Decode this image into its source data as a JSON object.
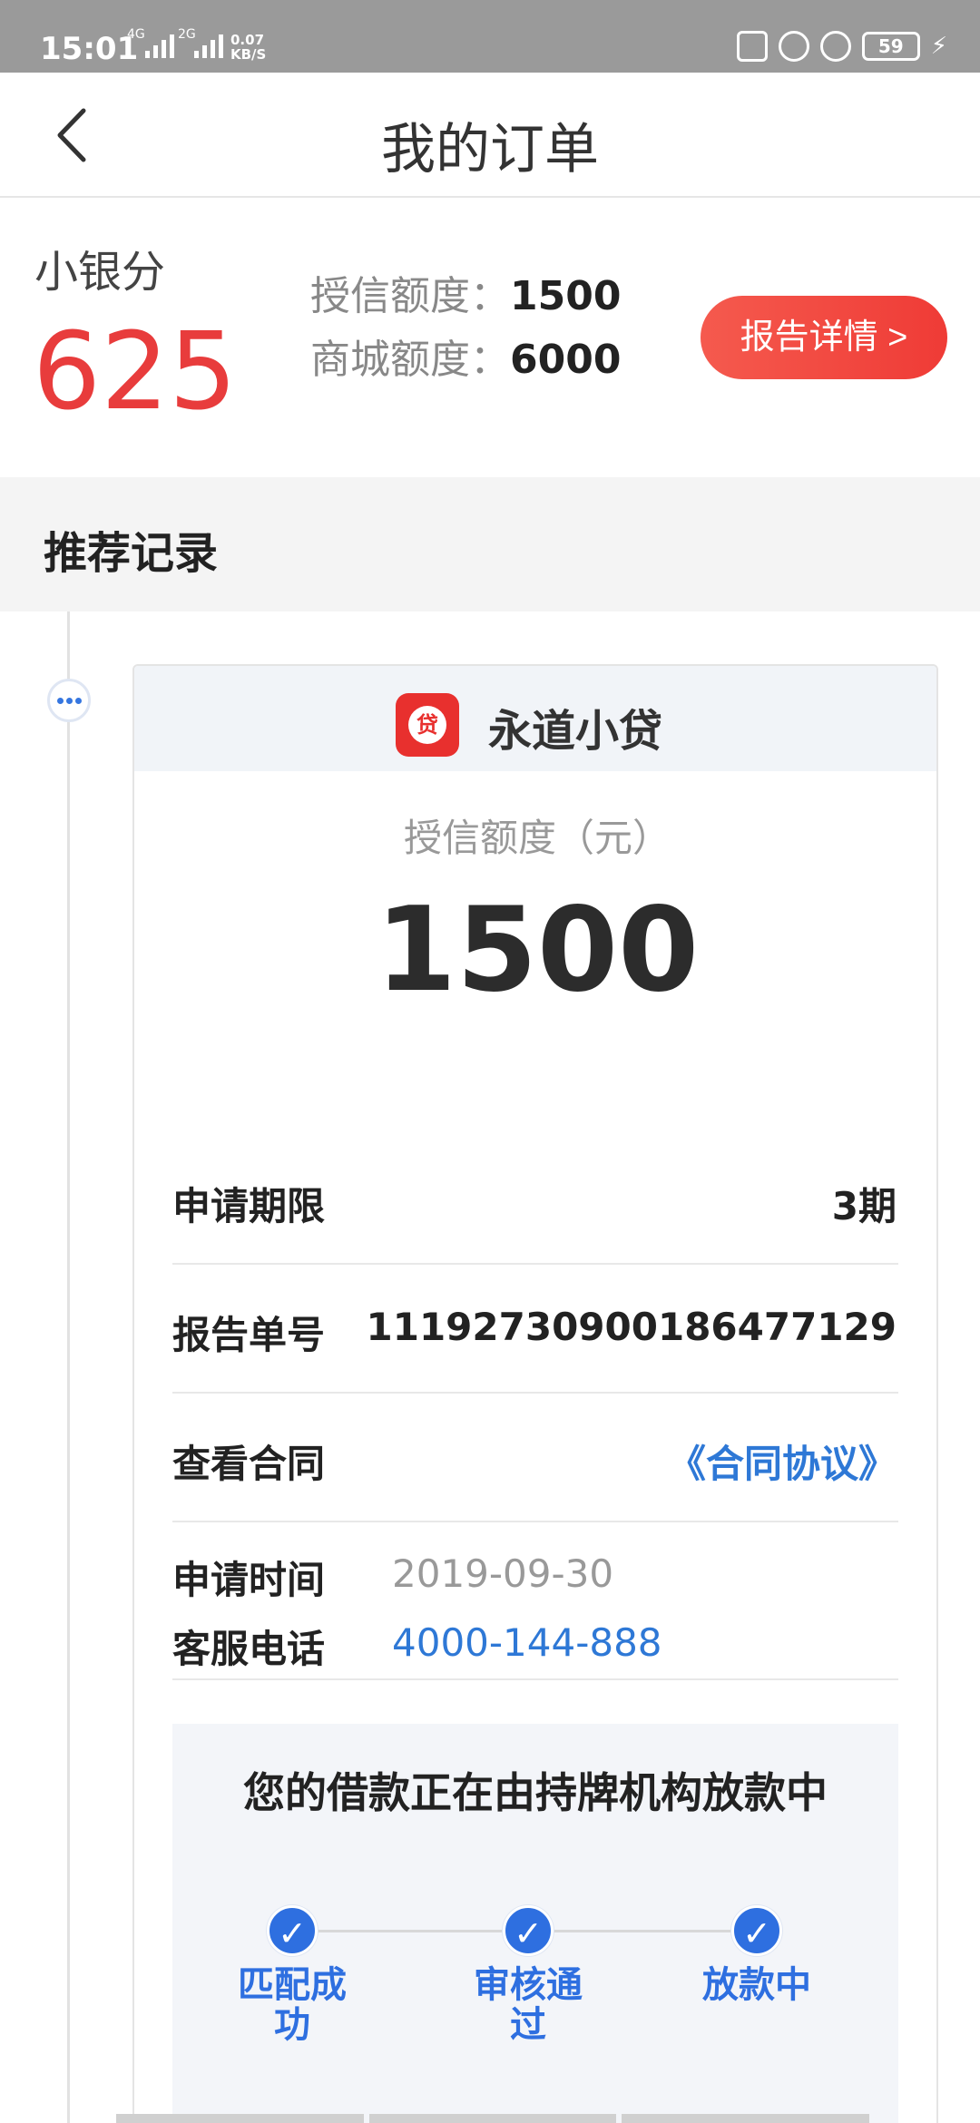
{
  "status_bar": {
    "time": "15:01",
    "net1": "4G",
    "net2": "2G",
    "speed_value": "0.07",
    "speed_unit": "KB/S",
    "battery": "59"
  },
  "header": {
    "title": "我的订单"
  },
  "score": {
    "label": "小银分",
    "value": "625",
    "credit_label": "授信额度：",
    "credit_value": "1500",
    "mall_label": "商城额度：",
    "mall_value": "6000",
    "report_button": "报告详情 >"
  },
  "records": {
    "title": "推荐记录"
  },
  "order": {
    "lender_name": "永道小贷",
    "logo_text": "贷",
    "amount_label": "授信额度（元）",
    "amount": "1500",
    "rows": [
      {
        "key": "申请期限",
        "value": "3期"
      },
      {
        "key": "报告单号",
        "value": "1119273090018647712​9"
      },
      {
        "key": "查看合同",
        "value": "《合同协议》"
      }
    ],
    "apply_time_label": "申请时间",
    "apply_time": "2019-09-30",
    "service_phone_label": "客服电话",
    "service_phone": "4000-144-888",
    "status_text": "您的借款正在由持牌机构放款中",
    "steps": [
      "匹配成功",
      "审核通过",
      "放款中"
    ]
  }
}
